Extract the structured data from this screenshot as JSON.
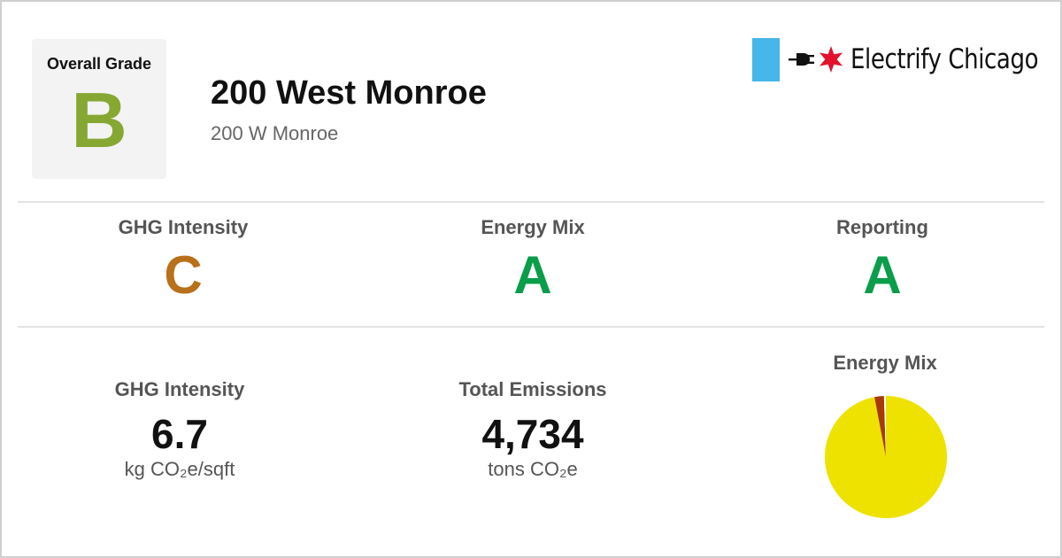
{
  "header": {
    "overall_grade_label": "Overall Grade",
    "overall_grade": "B",
    "building_name": "200 West Monroe",
    "address": "200 W Monroe"
  },
  "brand": {
    "name": "Electrify Chicago",
    "icons": [
      "flag-stripe",
      "plug-icon",
      "star-icon"
    ],
    "colors": {
      "flag_blue": "#47b6e8",
      "star_red": "#e3112b"
    }
  },
  "grades": [
    {
      "label": "GHG Intensity",
      "grade": "C",
      "color": "#b8701a"
    },
    {
      "label": "Energy Mix",
      "grade": "A",
      "color": "#0a9d4a"
    },
    {
      "label": "Reporting",
      "grade": "A",
      "color": "#0a9d4a"
    }
  ],
  "stats": {
    "ghg_intensity": {
      "label": "GHG Intensity",
      "value": "6.7",
      "unit": "kg CO₂e/sqft"
    },
    "total_emissions": {
      "label": "Total Emissions",
      "value": "4,734",
      "unit": "tons CO₂e"
    }
  },
  "colors": {
    "overall_grade": "#86a833"
  },
  "chart_data": {
    "type": "pie",
    "title": "Energy Mix",
    "slices": [
      {
        "value": 97,
        "color": "#ede200"
      },
      {
        "value": 2.5,
        "color": "#a83a06"
      },
      {
        "value": 0.5,
        "color": "#ffffff"
      }
    ]
  }
}
